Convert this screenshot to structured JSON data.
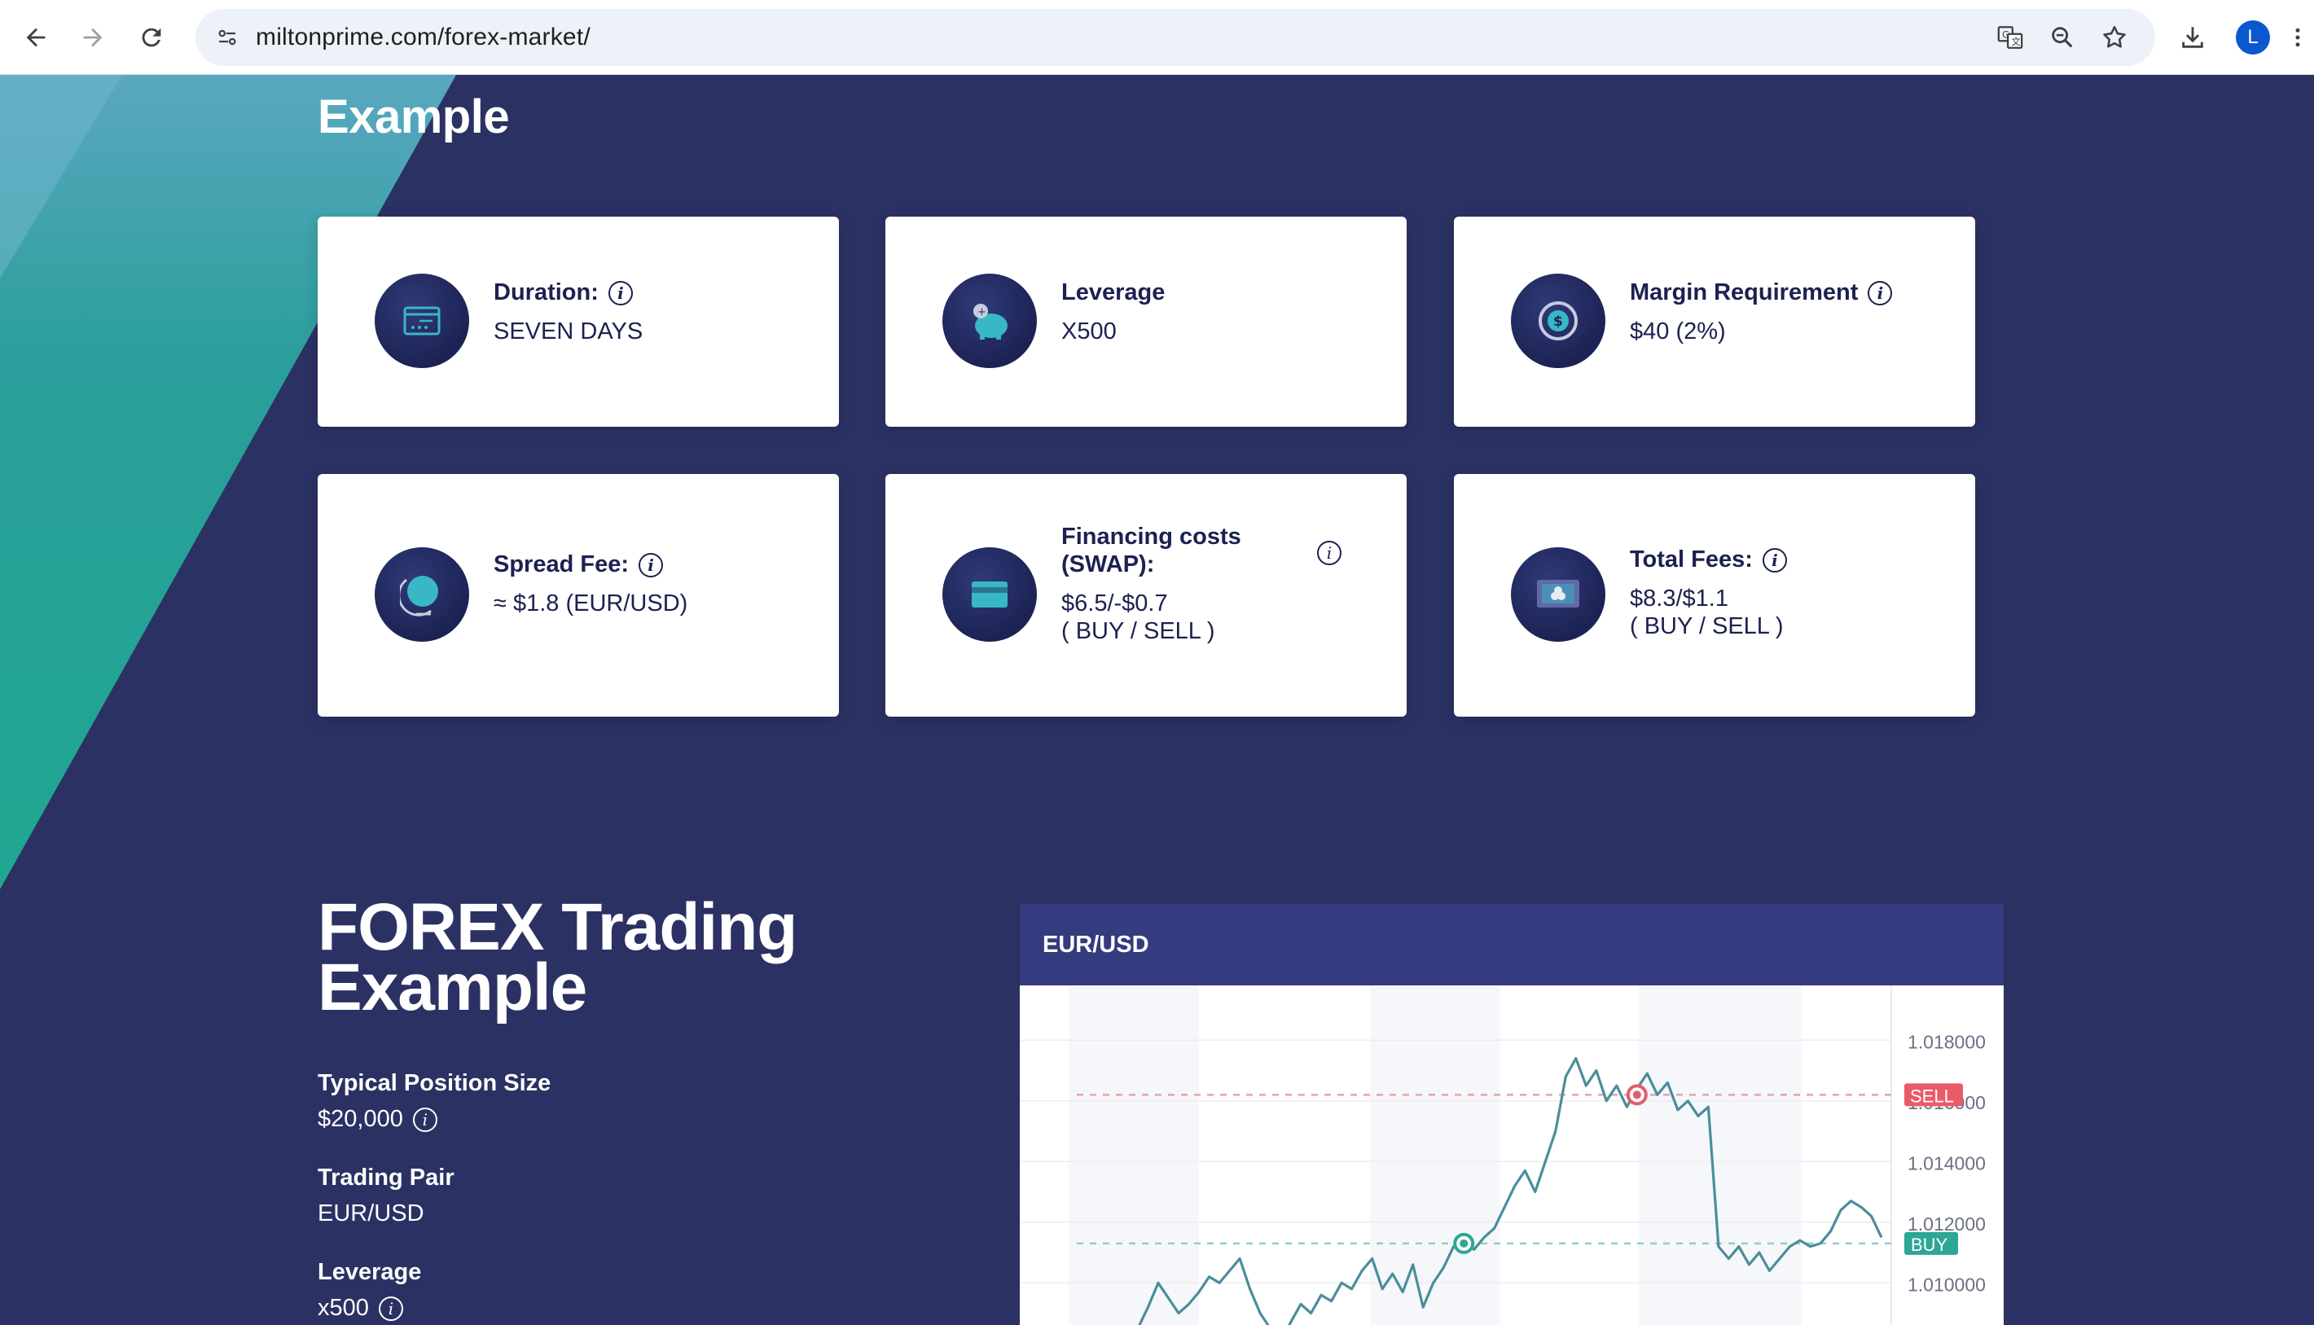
{
  "browser": {
    "url": "miltonprime.com/forex-market/",
    "avatar_letter": "L"
  },
  "section_top": {
    "title": "Example",
    "cards": [
      {
        "label": "Duration:",
        "value": "SEVEN DAYS",
        "info": true,
        "icon": "calendar-icon"
      },
      {
        "label": "Leverage",
        "value": "X500",
        "info": false,
        "icon": "piggy-bank-icon"
      },
      {
        "label": "Margin Requirement",
        "value": "$40 (2%)",
        "info": true,
        "icon": "dollar-coin-icon"
      },
      {
        "label": "Spread Fee:",
        "value": "≈ $1.8 (EUR/USD)",
        "info": true,
        "icon": "globe-icon"
      },
      {
        "label": "Financing costs (SWAP):",
        "value": "$6.5/-$0.7",
        "value2": "( BUY / SELL )",
        "info": true,
        "icon": "credit-card-icon"
      },
      {
        "label": "Total Fees:",
        "value": "$8.3/$1.1",
        "value2": "( BUY / SELL )",
        "info": true,
        "icon": "cash-stack-icon"
      }
    ]
  },
  "section_bottom": {
    "title": "FOREX Trading Example",
    "specs": [
      {
        "label": "Typical Position Size",
        "value": "$20,000",
        "info": true
      },
      {
        "label": "Trading Pair",
        "value": "EUR/USD",
        "info": false
      },
      {
        "label": "Leverage",
        "value": "x500",
        "info": true
      }
    ]
  },
  "chart_data": {
    "type": "line",
    "title": "EUR/USD",
    "y_ticks": [
      "1.018000",
      "1.016000",
      "1.014000",
      "1.012000",
      "1.010000"
    ],
    "ylim": [
      1.0088,
      1.019
    ],
    "sell_level": 1.0162,
    "buy_level": 1.0113,
    "markers": {
      "sell": "SELL",
      "buy": "BUY"
    },
    "series": [
      {
        "values": [
          1.0085,
          1.0092,
          1.01,
          1.0095,
          1.009,
          1.0093,
          1.0097,
          1.0102,
          1.01,
          1.0104,
          1.0108,
          1.0098,
          1.009,
          1.0085,
          1.008,
          1.0087,
          1.0093,
          1.009,
          1.0096,
          1.0094,
          1.01,
          1.0098,
          1.0104,
          1.0108,
          1.0098,
          1.0103,
          1.0097,
          1.0106,
          1.0092,
          1.01,
          1.0105,
          1.0112,
          1.0113,
          1.0111,
          1.0115,
          1.0118,
          1.0125,
          1.0132,
          1.0137,
          1.013,
          1.014,
          1.015,
          1.0168,
          1.0174,
          1.0165,
          1.017,
          1.016,
          1.0165,
          1.0158,
          1.0164,
          1.0169,
          1.0162,
          1.0166,
          1.0157,
          1.016,
          1.0155,
          1.0158,
          1.0112,
          1.0108,
          1.0112,
          1.0106,
          1.011,
          1.0104,
          1.0108,
          1.0112,
          1.0114,
          1.0112,
          1.0113,
          1.0117,
          1.0124,
          1.0127,
          1.0125,
          1.0122,
          1.0115
        ]
      }
    ]
  }
}
